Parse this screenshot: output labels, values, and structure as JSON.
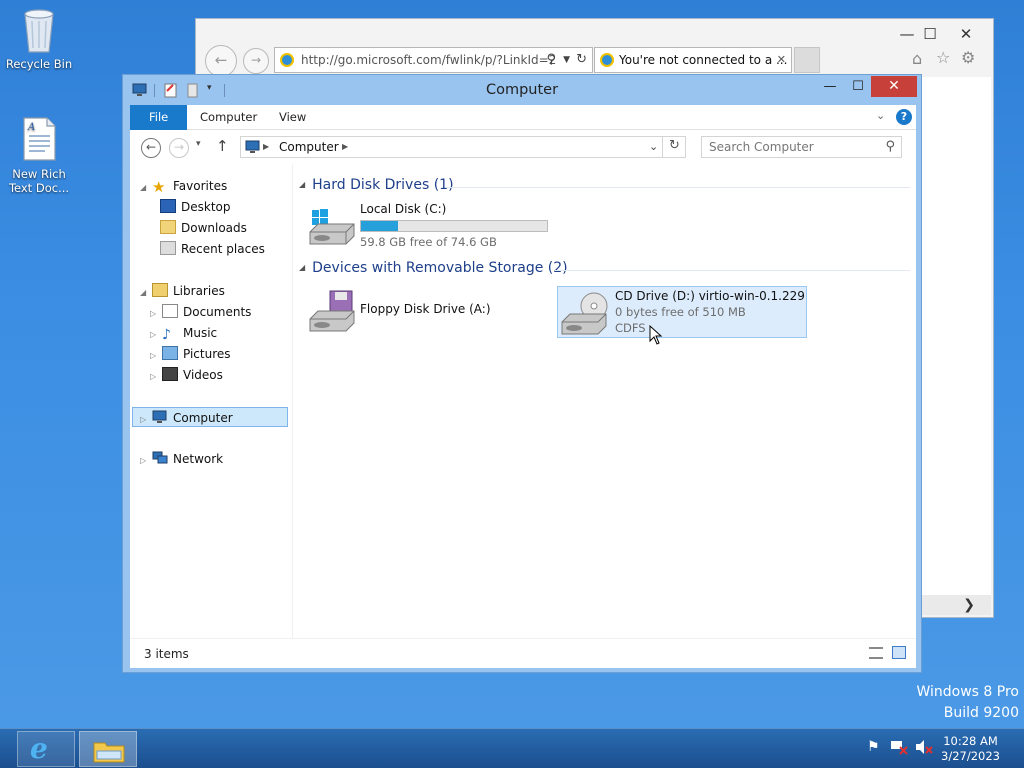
{
  "desktop": {
    "icons": [
      {
        "label": "Recycle Bin",
        "icon": "recycle-bin-icon"
      },
      {
        "label_line1": "New Rich",
        "label_line2": "Text Doc...",
        "icon": "rtf-document-icon"
      }
    ],
    "watermark": {
      "line1": "Windows 8 Pro",
      "line2": "Build 9200"
    }
  },
  "ie": {
    "address": "http://go.microsoft.com/fwlink/p/?LinkId=2",
    "tab_title": "You're not connected to a ...",
    "controls": {
      "minimize": "—",
      "maximize": "☐",
      "close": "✕"
    },
    "nav": {
      "back": "←",
      "forward": "→"
    },
    "toolbar_icons": [
      "home-icon",
      "favorites-star-icon",
      "settings-gear-icon"
    ]
  },
  "explorer": {
    "title": "Computer",
    "controls": {
      "minimize": "—",
      "maximize": "☐",
      "close": "✕"
    },
    "ribbon": {
      "tabs": [
        "File",
        "Computer",
        "View"
      ],
      "help": "?"
    },
    "nav": {
      "back": "←",
      "forward": "→",
      "recent": "▾",
      "up": "↑"
    },
    "address": {
      "segment": "Computer"
    },
    "search_placeholder": "Search Computer",
    "nav_pane": {
      "favorites": {
        "label": "Favorites",
        "items": [
          "Desktop",
          "Downloads",
          "Recent places"
        ]
      },
      "libraries": {
        "label": "Libraries",
        "items": [
          "Documents",
          "Music",
          "Pictures",
          "Videos"
        ]
      },
      "computer": "Computer",
      "network": "Network"
    },
    "groups": {
      "hard_disks": {
        "header": "Hard Disk Drives (1)",
        "drives": [
          {
            "name": "Local Disk (C:)",
            "free_text": "59.8 GB free of 74.6 GB",
            "used_fraction": 0.2
          }
        ]
      },
      "removable": {
        "header": "Devices with Removable Storage (2)",
        "floppy": {
          "name": "Floppy Disk Drive (A:)"
        },
        "cd": {
          "name": "CD Drive (D:) virtio-win-0.1.229",
          "free_text": "0 bytes free of 510 MB",
          "fs": "CDFS"
        }
      }
    },
    "status": {
      "items": "3 items"
    }
  },
  "taskbar": {
    "apps": [
      "internet-explorer-icon",
      "file-explorer-icon"
    ],
    "clock": {
      "time": "10:28 AM",
      "date": "3/27/2023"
    }
  },
  "colors": {
    "desktop": "#3b8ee3",
    "title_bar": "#9ac4f0",
    "close_button": "#c7413a",
    "file_tab": "#1979ca",
    "capacity_fill": "#26a0da",
    "group_header": "#1e3f8a"
  }
}
